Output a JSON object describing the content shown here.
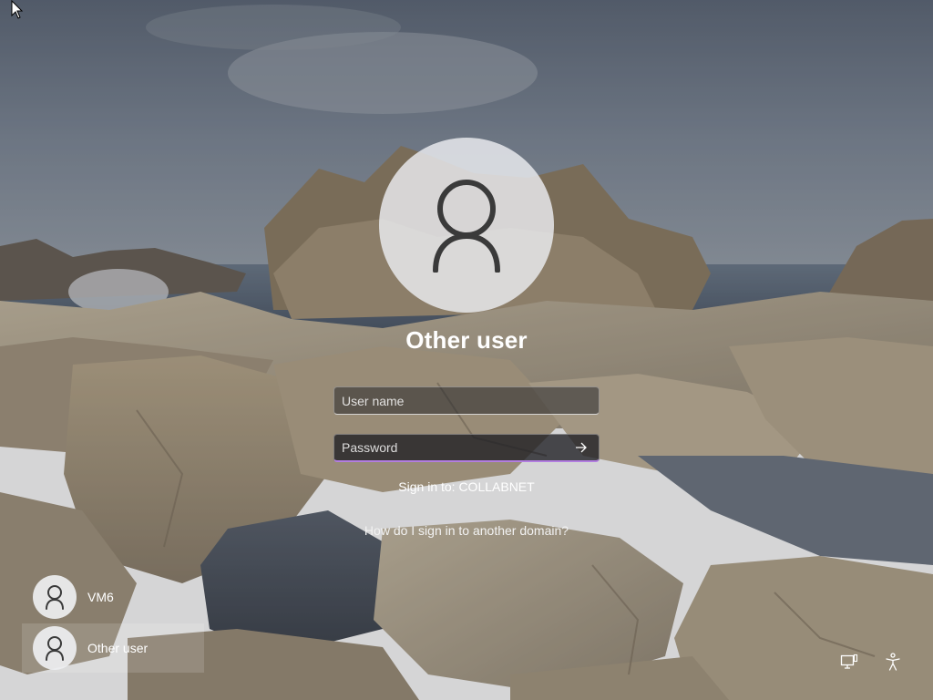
{
  "signin": {
    "title": "Other user",
    "username_placeholder": "User name",
    "password_placeholder": "Password",
    "signin_to": "Sign in to: COLLABNET",
    "domain_help_link": "How do I sign in to another domain?"
  },
  "users": [
    {
      "name": "VM6",
      "selected": false
    },
    {
      "name": "Other user",
      "selected": true
    }
  ],
  "icons": {
    "avatar": "person-icon",
    "submit": "arrow-right-icon",
    "network": "network-icon",
    "accessibility": "accessibility-icon"
  },
  "colors": {
    "focus_accent": "#b27de0"
  }
}
